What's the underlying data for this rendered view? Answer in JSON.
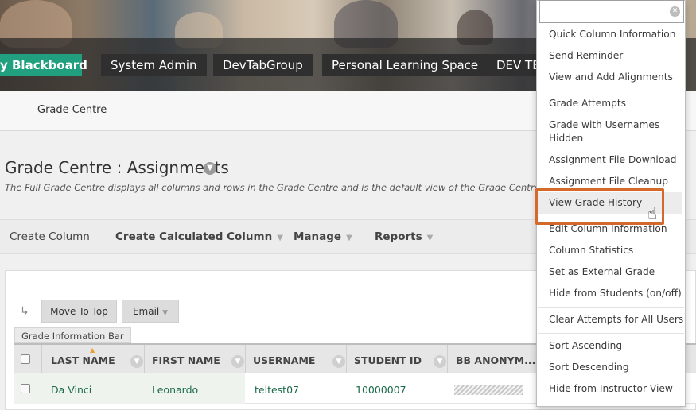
{
  "header": {
    "tabs": [
      "y Blackboard",
      "System Admin",
      "DevTabGroup",
      "Personal Learning Space",
      "DEV TEA"
    ],
    "breadcrumb": "Grade Centre"
  },
  "page": {
    "title": "Grade Centre : Assignments",
    "description": "The Full Grade Centre displays all columns and rows in the Grade Centre and is the default view of the Grade Centre. M"
  },
  "action_bar": {
    "create_column": "Create Column",
    "create_calculated_column": "Create Calculated Column",
    "manage": "Manage",
    "reports": "Reports"
  },
  "grid_toolbar": {
    "move_to_top": "Move To Top",
    "email": "Email",
    "info_bar": "Grade Information Bar"
  },
  "grid": {
    "columns": [
      "LAST NAME",
      "FIRST NAME",
      "USERNAME",
      "STUDENT ID",
      "BB ANONYM..."
    ],
    "rows": [
      {
        "last_name": "Da Vinci",
        "first_name": "Leonardo",
        "username": "teltest07",
        "student_id": "10000007"
      }
    ]
  },
  "menu": {
    "search_placeholder": "",
    "items": [
      "Quick Column Information",
      "Send Reminder",
      "View and Add Alignments",
      "Grade Attempts",
      "Grade with Usernames Hidden",
      "Assignment File Download",
      "Assignment File Cleanup",
      "View Grade History",
      "Edit Column Information",
      "Column Statistics",
      "Set as External Grade",
      "Hide from Students (on/off)",
      "Clear Attempts for All Users",
      "Sort Ascending",
      "Sort Descending",
      "Hide from Instructor View"
    ],
    "highlighted_item": "View Grade History"
  },
  "colors": {
    "active_tab": "#20a07f",
    "highlight_border": "#d3692a",
    "link": "#1b6a4a"
  }
}
